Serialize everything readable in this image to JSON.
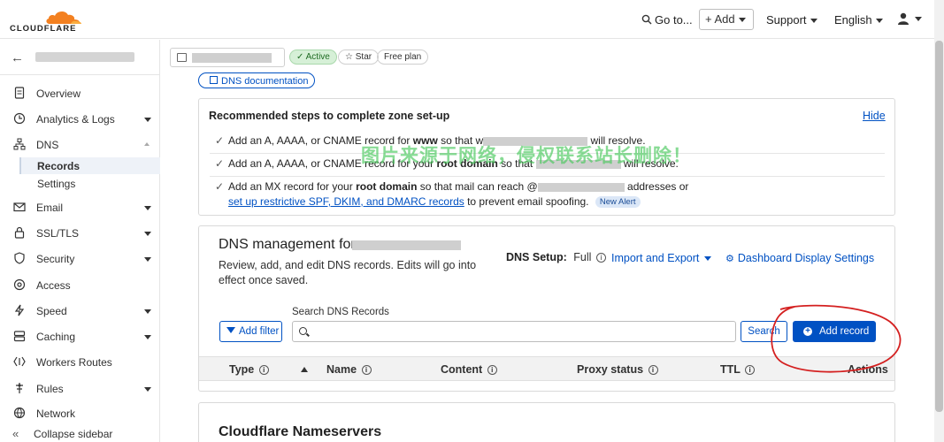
{
  "brand": {
    "wordmark": "CLOUDFLARE",
    "accent": "#f38020"
  },
  "topbar": {
    "goto_label": "Go to...",
    "add_label": "Add",
    "support_label": "Support",
    "language_label": "English"
  },
  "sidebar": {
    "items": [
      {
        "label": "Overview",
        "icon": "document-icon",
        "expandable": false
      },
      {
        "label": "Analytics & Logs",
        "icon": "clock-icon",
        "expandable": true
      },
      {
        "label": "DNS",
        "icon": "network-icon",
        "expandable": true,
        "expanded": true
      },
      {
        "label": "Email",
        "icon": "email-icon",
        "expandable": true
      },
      {
        "label": "SSL/TLS",
        "icon": "lock-icon",
        "expandable": true
      },
      {
        "label": "Security",
        "icon": "shield-icon",
        "expandable": true
      },
      {
        "label": "Access",
        "icon": "access-icon",
        "expandable": false
      },
      {
        "label": "Speed",
        "icon": "bolt-icon",
        "expandable": true
      },
      {
        "label": "Caching",
        "icon": "server-icon",
        "expandable": true
      },
      {
        "label": "Workers Routes",
        "icon": "workers-icon",
        "expandable": false
      },
      {
        "label": "Rules",
        "icon": "rules-icon",
        "expandable": true
      },
      {
        "label": "Network",
        "icon": "globe-icon",
        "expandable": false
      }
    ],
    "dns_sub": [
      {
        "label": "Records",
        "active": true
      },
      {
        "label": "Settings",
        "active": false
      }
    ],
    "collapse_label": "Collapse sidebar"
  },
  "zone": {
    "status": "Active",
    "star": "Star",
    "plan": "Free plan"
  },
  "content": {
    "doc_link": "DNS documentation",
    "steps": {
      "title": "Recommended steps to complete zone set-up",
      "hide": "Hide",
      "step1_a": "Add an A, AAAA, or CNAME record for",
      "step1_b": "www",
      "step1_c": "so that w",
      "step1_d": "will resolve.",
      "step2_a": "Add an A, AAAA, or CNAME record for your",
      "step2_b": "root domain",
      "step2_c": "so that",
      "step2_d": "will resolve.",
      "step3_a": "Add an MX record for your",
      "step3_b": "root domain",
      "step3_c": "so that mail can reach @",
      "step3_d": "addresses or",
      "step3_link": "set up restrictive SPF, DKIM, and DMARC records",
      "step3_e": "to prevent email spoofing.",
      "step3_badge": "New Alert"
    },
    "dns": {
      "title": "DNS management for",
      "desc": "Review, add, and edit DNS records. Edits will go into effect once saved.",
      "setup_label": "DNS Setup:",
      "setup_value": "Full",
      "import_export": "Import and Export",
      "display_settings": "Dashboard Display Settings",
      "search_label": "Search DNS Records",
      "search_value": "",
      "add_filter": "Add filter",
      "search_button": "Search",
      "add_record": "Add record",
      "columns": [
        "Type",
        "Name",
        "Content",
        "Proxy status",
        "TTL",
        "Actions"
      ]
    },
    "nameservers_title": "Cloudflare Nameservers"
  },
  "watermark": "图片来源于网络，侵权联系站长删除！",
  "colors": {
    "link": "#0051c3",
    "primary_button": "#0051c3",
    "active_pill": "#d6f0d7",
    "annotation": "#d42020"
  }
}
